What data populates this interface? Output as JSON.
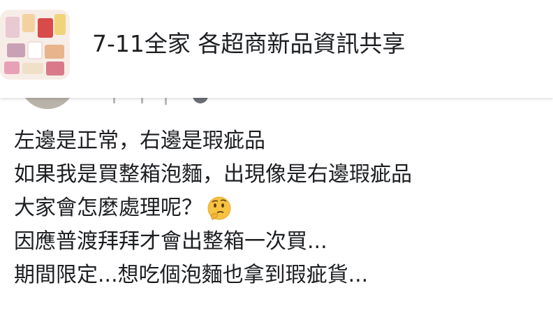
{
  "group": {
    "name": "7-11全家 各超商新品資訊共享",
    "avatar_icon": "group-cover-thumbnail"
  },
  "post": {
    "lines": [
      "左邊是正常，右邊是瑕疵品",
      "如果我是買整箱泡麵，出現像是右邊瑕疵品",
      "大家會怎麼處理呢？",
      "因應普渡拜拜才會出整箱一次買...",
      "期間限定...想吃個泡麵也拿到瑕疵貨..."
    ],
    "emoji": "thinking-face-icon"
  },
  "colors": {
    "text": "#1c1e21",
    "muted": "#8a8d91",
    "background": "#ffffff"
  }
}
